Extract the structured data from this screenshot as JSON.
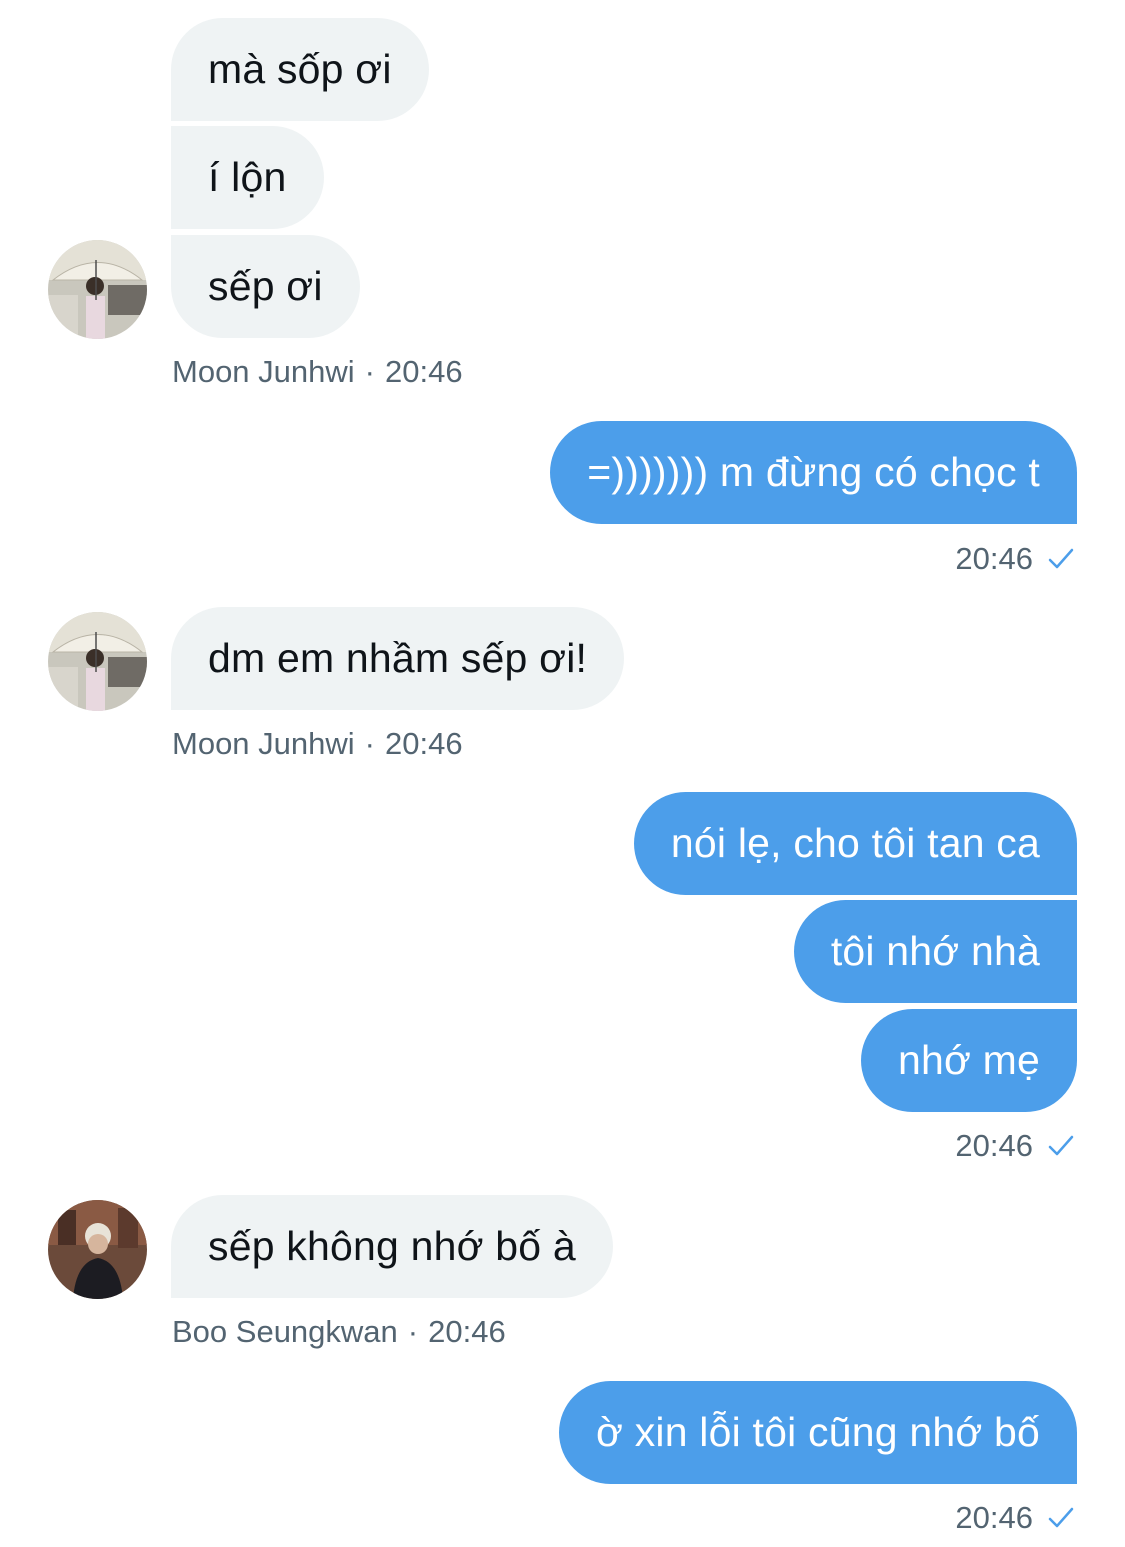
{
  "messages": {
    "g1": {
      "m1": "mà sốp ơi",
      "m2": "í lộn",
      "m3": "sếp ơi",
      "sender": "Moon Junhwi",
      "time": "20:46"
    },
    "o1": {
      "m1": "=))))))) m đừng có chọc t",
      "time": "20:46"
    },
    "g2": {
      "m1": "dm em nhầm sếp ơi!",
      "sender": "Moon Junhwi",
      "time": "20:46"
    },
    "o2": {
      "m1": "nói lẹ, cho tôi tan ca",
      "m2": "tôi nhớ nhà",
      "m3": "nhớ mẹ",
      "time": "20:46"
    },
    "g3": {
      "m1": "sếp không nhớ bố à",
      "sender": "Boo Seungkwan",
      "time": "20:46"
    },
    "o3": {
      "m1": "ờ xin lỗi tôi cũng nhớ bố",
      "time": "20:46"
    }
  },
  "meta": {
    "separator": "·"
  },
  "icons": {
    "read_receipt": "check-icon",
    "avatar_1": "avatar-photo",
    "avatar_2": "avatar-photo"
  },
  "colors": {
    "outgoing_bubble": "#4c9eea",
    "incoming_bubble": "#eff3f4",
    "meta_text": "#536471",
    "check": "#4c9eea"
  }
}
